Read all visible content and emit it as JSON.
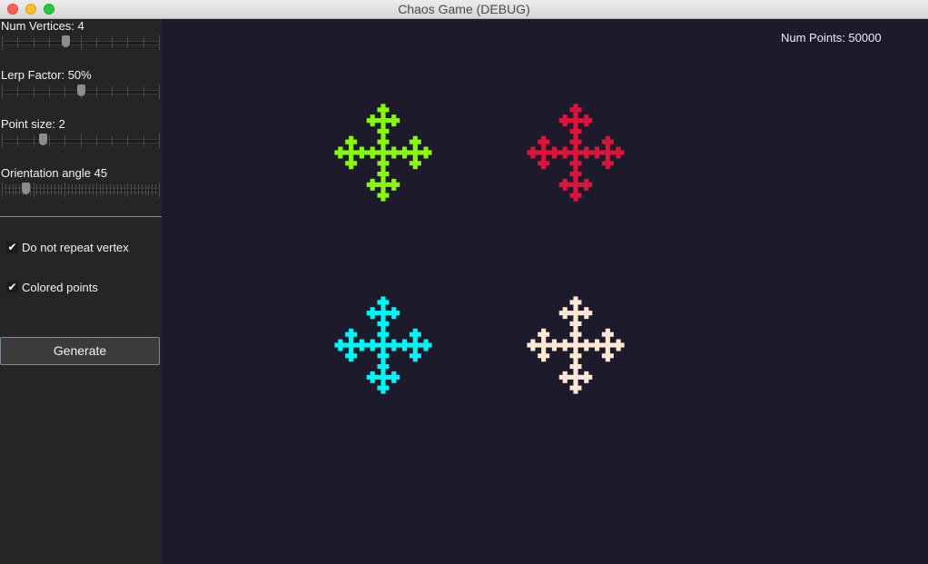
{
  "window": {
    "title": "Chaos Game (DEBUG)"
  },
  "sidebar": {
    "sliders": [
      {
        "label": "Num Vertices: 4",
        "value": 0.4
      },
      {
        "label": "Lerp Factor: 50%",
        "value": 0.5
      },
      {
        "label": "Point size: 2",
        "value": 0.26
      },
      {
        "label": "Orientation angle 45",
        "value": 0.15
      }
    ],
    "checkboxes": [
      {
        "label": "Do not repeat vertex",
        "checked": true,
        "mark": "✔"
      },
      {
        "label": "Colored points",
        "checked": true,
        "mark": "✔"
      }
    ],
    "generate_label": "Generate"
  },
  "canvas": {
    "num_points_text": "Num Points: 50000",
    "background": "#1d1a2c",
    "colors": {
      "top_left": "#88f70f",
      "top_right": "#dc143c",
      "bottom_left": "#00f5f5",
      "bottom_right": "#fbe7d3"
    }
  }
}
